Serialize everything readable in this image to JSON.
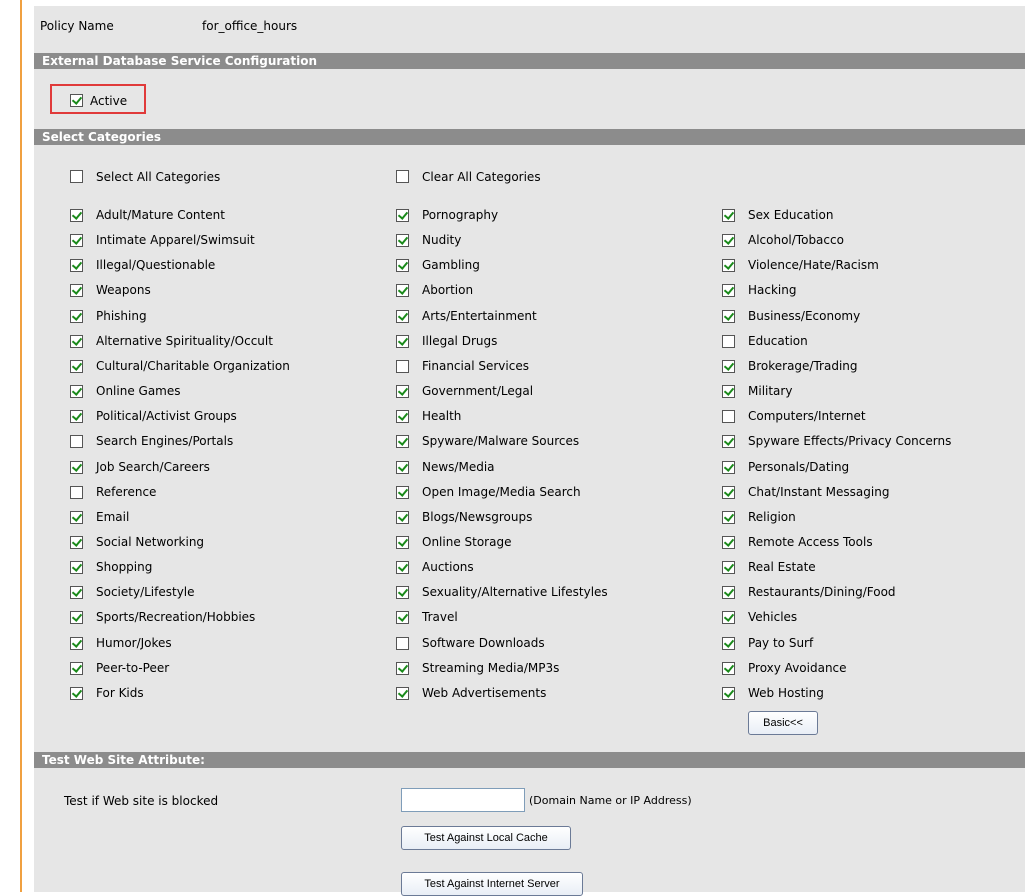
{
  "policy": {
    "label": "Policy Name",
    "value": "for_office_hours"
  },
  "sections": {
    "external_db": "External Database Service Configuration",
    "select_categories": "Select Categories",
    "test_site": "Test Web Site Attribute:"
  },
  "active": {
    "label": "Active",
    "checked": true
  },
  "select_all": {
    "label": "Select All Categories",
    "checked": false
  },
  "clear_all": {
    "label": "Clear All Categories",
    "checked": false
  },
  "categories": {
    "col1": [
      {
        "label": "Adult/Mature Content",
        "checked": true
      },
      {
        "label": "Intimate Apparel/Swimsuit",
        "checked": true
      },
      {
        "label": "Illegal/Questionable",
        "checked": true
      },
      {
        "label": "Weapons",
        "checked": true
      },
      {
        "label": "Phishing",
        "checked": true
      },
      {
        "label": "Alternative Spirituality/Occult",
        "checked": true
      },
      {
        "label": "Cultural/Charitable Organization",
        "checked": true
      },
      {
        "label": "Online Games",
        "checked": true
      },
      {
        "label": "Political/Activist Groups",
        "checked": true
      },
      {
        "label": "Search Engines/Portals",
        "checked": false
      },
      {
        "label": "Job Search/Careers",
        "checked": true
      },
      {
        "label": "Reference",
        "checked": false
      },
      {
        "label": "Email",
        "checked": true
      },
      {
        "label": "Social Networking",
        "checked": true
      },
      {
        "label": "Shopping",
        "checked": true
      },
      {
        "label": "Society/Lifestyle",
        "checked": true
      },
      {
        "label": "Sports/Recreation/Hobbies",
        "checked": true
      },
      {
        "label": "Humor/Jokes",
        "checked": true
      },
      {
        "label": "Peer-to-Peer",
        "checked": true
      },
      {
        "label": "For Kids",
        "checked": true
      }
    ],
    "col2": [
      {
        "label": "Pornography",
        "checked": true
      },
      {
        "label": "Nudity",
        "checked": true
      },
      {
        "label": "Gambling",
        "checked": true
      },
      {
        "label": "Abortion",
        "checked": true
      },
      {
        "label": "Arts/Entertainment",
        "checked": true
      },
      {
        "label": "Illegal Drugs",
        "checked": true
      },
      {
        "label": "Financial Services",
        "checked": false
      },
      {
        "label": "Government/Legal",
        "checked": true
      },
      {
        "label": "Health",
        "checked": true
      },
      {
        "label": "Spyware/Malware Sources",
        "checked": true
      },
      {
        "label": "News/Media",
        "checked": true
      },
      {
        "label": "Open Image/Media Search",
        "checked": true
      },
      {
        "label": "Blogs/Newsgroups",
        "checked": true
      },
      {
        "label": "Online Storage",
        "checked": true
      },
      {
        "label": "Auctions",
        "checked": true
      },
      {
        "label": "Sexuality/Alternative Lifestyles",
        "checked": true
      },
      {
        "label": "Travel",
        "checked": true
      },
      {
        "label": "Software Downloads",
        "checked": false
      },
      {
        "label": "Streaming Media/MP3s",
        "checked": true
      },
      {
        "label": "Web Advertisements",
        "checked": true
      }
    ],
    "col3": [
      {
        "label": "Sex Education",
        "checked": true
      },
      {
        "label": "Alcohol/Tobacco",
        "checked": true
      },
      {
        "label": "Violence/Hate/Racism",
        "checked": true
      },
      {
        "label": "Hacking",
        "checked": true
      },
      {
        "label": "Business/Economy",
        "checked": true
      },
      {
        "label": "Education",
        "checked": false
      },
      {
        "label": "Brokerage/Trading",
        "checked": true
      },
      {
        "label": "Military",
        "checked": true
      },
      {
        "label": "Computers/Internet",
        "checked": false
      },
      {
        "label": "Spyware Effects/Privacy Concerns",
        "checked": true
      },
      {
        "label": "Personals/Dating",
        "checked": true
      },
      {
        "label": "Chat/Instant Messaging",
        "checked": true
      },
      {
        "label": "Religion",
        "checked": true
      },
      {
        "label": "Remote Access Tools",
        "checked": true
      },
      {
        "label": "Real Estate",
        "checked": true
      },
      {
        "label": "Restaurants/Dining/Food",
        "checked": true
      },
      {
        "label": "Vehicles",
        "checked": true
      },
      {
        "label": "Pay to Surf",
        "checked": true
      },
      {
        "label": "Proxy Avoidance",
        "checked": true
      },
      {
        "label": "Web Hosting",
        "checked": true
      }
    ]
  },
  "basic_button": "Basic<<",
  "test": {
    "label": "Test if Web site is blocked",
    "input_value": "",
    "hint": "(Domain Name or IP Address)",
    "local_cache_button": "Test Against Local Cache",
    "internet_server_button": "Test Against Internet Server"
  }
}
